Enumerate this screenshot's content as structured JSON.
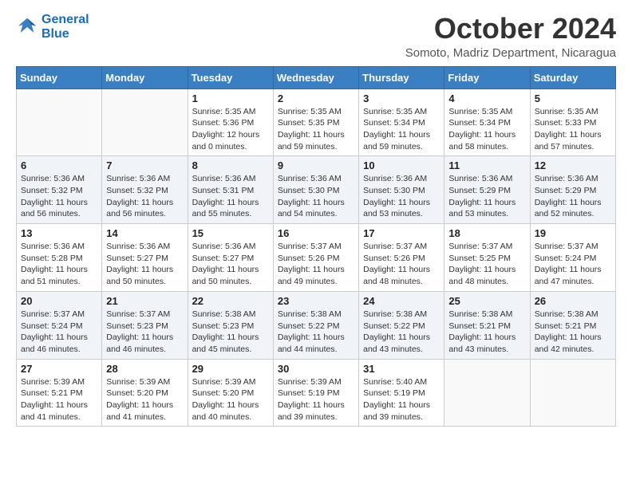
{
  "logo": {
    "line1": "General",
    "line2": "Blue"
  },
  "header": {
    "month": "October 2024",
    "location": "Somoto, Madriz Department, Nicaragua"
  },
  "weekdays": [
    "Sunday",
    "Monday",
    "Tuesday",
    "Wednesday",
    "Thursday",
    "Friday",
    "Saturday"
  ],
  "weeks": [
    [
      {
        "day": "",
        "text": ""
      },
      {
        "day": "",
        "text": ""
      },
      {
        "day": "1",
        "text": "Sunrise: 5:35 AM\nSunset: 5:36 PM\nDaylight: 12 hours\nand 0 minutes."
      },
      {
        "day": "2",
        "text": "Sunrise: 5:35 AM\nSunset: 5:35 PM\nDaylight: 11 hours\nand 59 minutes."
      },
      {
        "day": "3",
        "text": "Sunrise: 5:35 AM\nSunset: 5:34 PM\nDaylight: 11 hours\nand 59 minutes."
      },
      {
        "day": "4",
        "text": "Sunrise: 5:35 AM\nSunset: 5:34 PM\nDaylight: 11 hours\nand 58 minutes."
      },
      {
        "day": "5",
        "text": "Sunrise: 5:35 AM\nSunset: 5:33 PM\nDaylight: 11 hours\nand 57 minutes."
      }
    ],
    [
      {
        "day": "6",
        "text": "Sunrise: 5:36 AM\nSunset: 5:32 PM\nDaylight: 11 hours\nand 56 minutes."
      },
      {
        "day": "7",
        "text": "Sunrise: 5:36 AM\nSunset: 5:32 PM\nDaylight: 11 hours\nand 56 minutes."
      },
      {
        "day": "8",
        "text": "Sunrise: 5:36 AM\nSunset: 5:31 PM\nDaylight: 11 hours\nand 55 minutes."
      },
      {
        "day": "9",
        "text": "Sunrise: 5:36 AM\nSunset: 5:30 PM\nDaylight: 11 hours\nand 54 minutes."
      },
      {
        "day": "10",
        "text": "Sunrise: 5:36 AM\nSunset: 5:30 PM\nDaylight: 11 hours\nand 53 minutes."
      },
      {
        "day": "11",
        "text": "Sunrise: 5:36 AM\nSunset: 5:29 PM\nDaylight: 11 hours\nand 53 minutes."
      },
      {
        "day": "12",
        "text": "Sunrise: 5:36 AM\nSunset: 5:29 PM\nDaylight: 11 hours\nand 52 minutes."
      }
    ],
    [
      {
        "day": "13",
        "text": "Sunrise: 5:36 AM\nSunset: 5:28 PM\nDaylight: 11 hours\nand 51 minutes."
      },
      {
        "day": "14",
        "text": "Sunrise: 5:36 AM\nSunset: 5:27 PM\nDaylight: 11 hours\nand 50 minutes."
      },
      {
        "day": "15",
        "text": "Sunrise: 5:36 AM\nSunset: 5:27 PM\nDaylight: 11 hours\nand 50 minutes."
      },
      {
        "day": "16",
        "text": "Sunrise: 5:37 AM\nSunset: 5:26 PM\nDaylight: 11 hours\nand 49 minutes."
      },
      {
        "day": "17",
        "text": "Sunrise: 5:37 AM\nSunset: 5:26 PM\nDaylight: 11 hours\nand 48 minutes."
      },
      {
        "day": "18",
        "text": "Sunrise: 5:37 AM\nSunset: 5:25 PM\nDaylight: 11 hours\nand 48 minutes."
      },
      {
        "day": "19",
        "text": "Sunrise: 5:37 AM\nSunset: 5:24 PM\nDaylight: 11 hours\nand 47 minutes."
      }
    ],
    [
      {
        "day": "20",
        "text": "Sunrise: 5:37 AM\nSunset: 5:24 PM\nDaylight: 11 hours\nand 46 minutes."
      },
      {
        "day": "21",
        "text": "Sunrise: 5:37 AM\nSunset: 5:23 PM\nDaylight: 11 hours\nand 46 minutes."
      },
      {
        "day": "22",
        "text": "Sunrise: 5:38 AM\nSunset: 5:23 PM\nDaylight: 11 hours\nand 45 minutes."
      },
      {
        "day": "23",
        "text": "Sunrise: 5:38 AM\nSunset: 5:22 PM\nDaylight: 11 hours\nand 44 minutes."
      },
      {
        "day": "24",
        "text": "Sunrise: 5:38 AM\nSunset: 5:22 PM\nDaylight: 11 hours\nand 43 minutes."
      },
      {
        "day": "25",
        "text": "Sunrise: 5:38 AM\nSunset: 5:21 PM\nDaylight: 11 hours\nand 43 minutes."
      },
      {
        "day": "26",
        "text": "Sunrise: 5:38 AM\nSunset: 5:21 PM\nDaylight: 11 hours\nand 42 minutes."
      }
    ],
    [
      {
        "day": "27",
        "text": "Sunrise: 5:39 AM\nSunset: 5:21 PM\nDaylight: 11 hours\nand 41 minutes."
      },
      {
        "day": "28",
        "text": "Sunrise: 5:39 AM\nSunset: 5:20 PM\nDaylight: 11 hours\nand 41 minutes."
      },
      {
        "day": "29",
        "text": "Sunrise: 5:39 AM\nSunset: 5:20 PM\nDaylight: 11 hours\nand 40 minutes."
      },
      {
        "day": "30",
        "text": "Sunrise: 5:39 AM\nSunset: 5:19 PM\nDaylight: 11 hours\nand 39 minutes."
      },
      {
        "day": "31",
        "text": "Sunrise: 5:40 AM\nSunset: 5:19 PM\nDaylight: 11 hours\nand 39 minutes."
      },
      {
        "day": "",
        "text": ""
      },
      {
        "day": "",
        "text": ""
      }
    ]
  ]
}
